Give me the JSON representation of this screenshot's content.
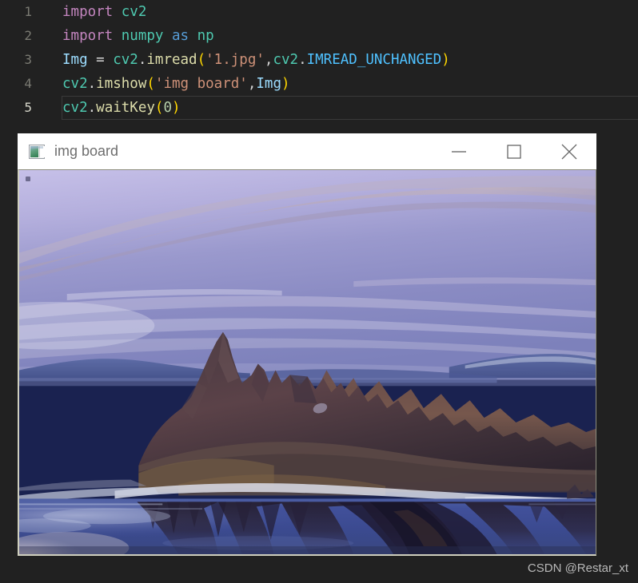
{
  "editor": {
    "background": "#212121",
    "lines": [
      {
        "number": "1",
        "current": false,
        "tokens": [
          {
            "text": "import",
            "type": "kw"
          },
          {
            "text": " ",
            "type": "op"
          },
          {
            "text": "cv2",
            "type": "mod"
          }
        ]
      },
      {
        "number": "2",
        "current": false,
        "tokens": [
          {
            "text": "import",
            "type": "kw"
          },
          {
            "text": " ",
            "type": "op"
          },
          {
            "text": "numpy",
            "type": "mod"
          },
          {
            "text": " ",
            "type": "op"
          },
          {
            "text": "as",
            "type": "as"
          },
          {
            "text": " ",
            "type": "op"
          },
          {
            "text": "np",
            "type": "mod"
          }
        ]
      },
      {
        "number": "3",
        "current": false,
        "tokens": [
          {
            "text": "Img",
            "type": "var"
          },
          {
            "text": " = ",
            "type": "op"
          },
          {
            "text": "cv2",
            "type": "mod"
          },
          {
            "text": ".",
            "type": "op"
          },
          {
            "text": "imread",
            "type": "fn"
          },
          {
            "text": "(",
            "type": "punc"
          },
          {
            "text": "'1.jpg'",
            "type": "str"
          },
          {
            "text": ",",
            "type": "comma"
          },
          {
            "text": "cv2",
            "type": "mod"
          },
          {
            "text": ".",
            "type": "op"
          },
          {
            "text": "IMREAD_UNCHANGED",
            "type": "const"
          },
          {
            "text": ")",
            "type": "punc"
          }
        ]
      },
      {
        "number": "4",
        "current": false,
        "tokens": [
          {
            "text": "cv2",
            "type": "mod"
          },
          {
            "text": ".",
            "type": "op"
          },
          {
            "text": "imshow",
            "type": "fn"
          },
          {
            "text": "(",
            "type": "punc"
          },
          {
            "text": "'img board'",
            "type": "str"
          },
          {
            "text": ",",
            "type": "comma"
          },
          {
            "text": "Img",
            "type": "var"
          },
          {
            "text": ")",
            "type": "punc"
          }
        ]
      },
      {
        "number": "5",
        "current": true,
        "tokens": [
          {
            "text": "cv2",
            "type": "mod"
          },
          {
            "text": ".",
            "type": "op"
          },
          {
            "text": "waitKey",
            "type": "fn"
          },
          {
            "text": "(",
            "type": "punc"
          },
          {
            "text": "0",
            "type": "num"
          },
          {
            "text": ")",
            "type": "punc"
          }
        ]
      }
    ]
  },
  "window": {
    "title": "img board",
    "icon": "image-window-icon",
    "titlebar_background": "#ffffff",
    "title_color": "#6e6e6e",
    "controls": [
      {
        "name": "minimize-button",
        "glyph": "minimize-icon"
      },
      {
        "name": "maximize-button",
        "glyph": "maximize-icon"
      },
      {
        "name": "close-button",
        "glyph": "close-icon"
      }
    ]
  },
  "photo": {
    "description": "Mono Lake tufa rock formation at dusk reflected in still water",
    "sky_top": "#b9b4e0",
    "sky_mid": "#8d8cc4",
    "water": "#3b4a8c",
    "rock": "#3a2f3f"
  },
  "watermark": {
    "text": "CSDN @Restar_xt",
    "color": "#b9b9b9"
  }
}
